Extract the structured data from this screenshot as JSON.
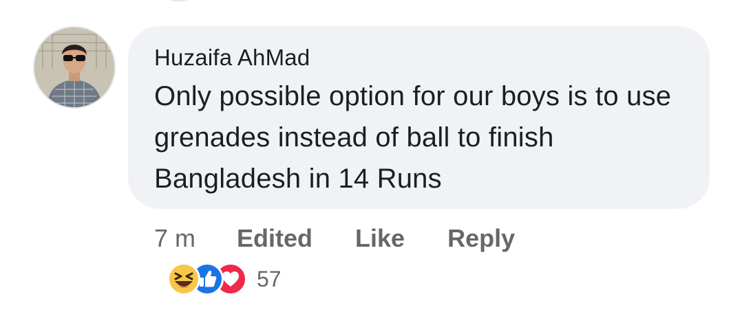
{
  "comment": {
    "author": "Huzaifa AhMad",
    "text": "Only possible option for our boys is to use grenades instead of ball to finish Bangladesh in 14 Runs"
  },
  "meta": {
    "time": "7 m",
    "edited_label": "Edited",
    "like_label": "Like",
    "reply_label": "Reply"
  },
  "reactions": {
    "icons": [
      "haha-icon",
      "like-icon",
      "love-icon"
    ],
    "count": "57"
  },
  "colors": {
    "bubble": "#f0f2f5",
    "text": "#1c1e21",
    "meta": "#65676b",
    "like": "#1b74e4",
    "love": "#f0284a",
    "haha": "#f7c74a"
  }
}
